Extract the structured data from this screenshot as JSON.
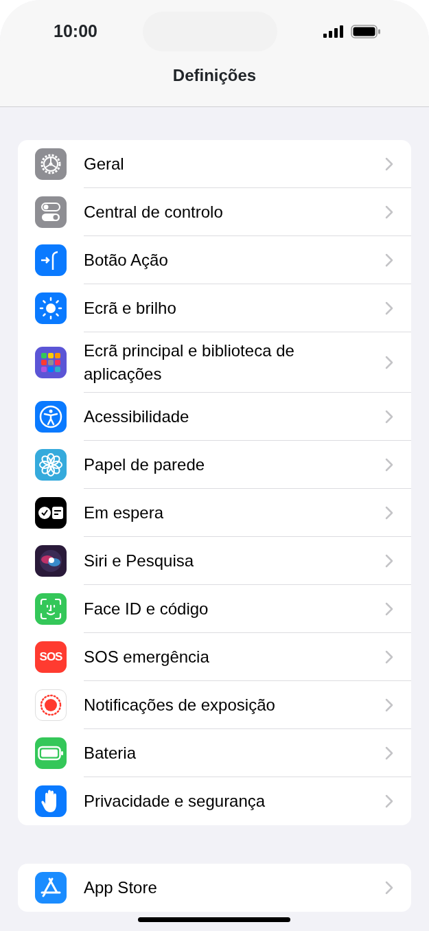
{
  "status_bar": {
    "time": "10:00"
  },
  "nav": {
    "title": "Definições"
  },
  "groups": [
    {
      "items": [
        {
          "label": "Geral",
          "kind": "gear",
          "color": "#8e8e93"
        },
        {
          "label": "Central de controlo",
          "kind": "toggles",
          "color": "#8e8e93"
        },
        {
          "label": "Botão Ação",
          "kind": "action",
          "color": "#0a7aff"
        },
        {
          "label": "Ecrã e brilho",
          "kind": "sun",
          "color": "#0a7aff"
        },
        {
          "label": "Ecrã principal e biblioteca de aplicações",
          "kind": "grid",
          "color": "#5b55d6"
        },
        {
          "label": "Acessibilidade",
          "kind": "person",
          "color": "#0a7aff"
        },
        {
          "label": "Papel de parede",
          "kind": "flower",
          "color": "#35aadc"
        },
        {
          "label": "Em espera",
          "kind": "standby",
          "color": "#000000"
        },
        {
          "label": "Siri e Pesquisa",
          "kind": "siri",
          "color": "#2a1a3a"
        },
        {
          "label": "Face ID e código",
          "kind": "face",
          "color": "#34c759"
        },
        {
          "label": "SOS emergência",
          "kind": "sos",
          "icon_text": "SOS",
          "color": "#ff3b30"
        },
        {
          "label": "Notificações de exposição",
          "kind": "exposure",
          "color": "#ffffff"
        },
        {
          "label": "Bateria",
          "kind": "battery",
          "color": "#34c759"
        },
        {
          "label": "Privacidade e segurança",
          "kind": "hand",
          "color": "#0a7aff"
        }
      ]
    },
    {
      "items": [
        {
          "label": "App Store",
          "kind": "appstore",
          "color": "#1a8cff"
        }
      ]
    }
  ]
}
